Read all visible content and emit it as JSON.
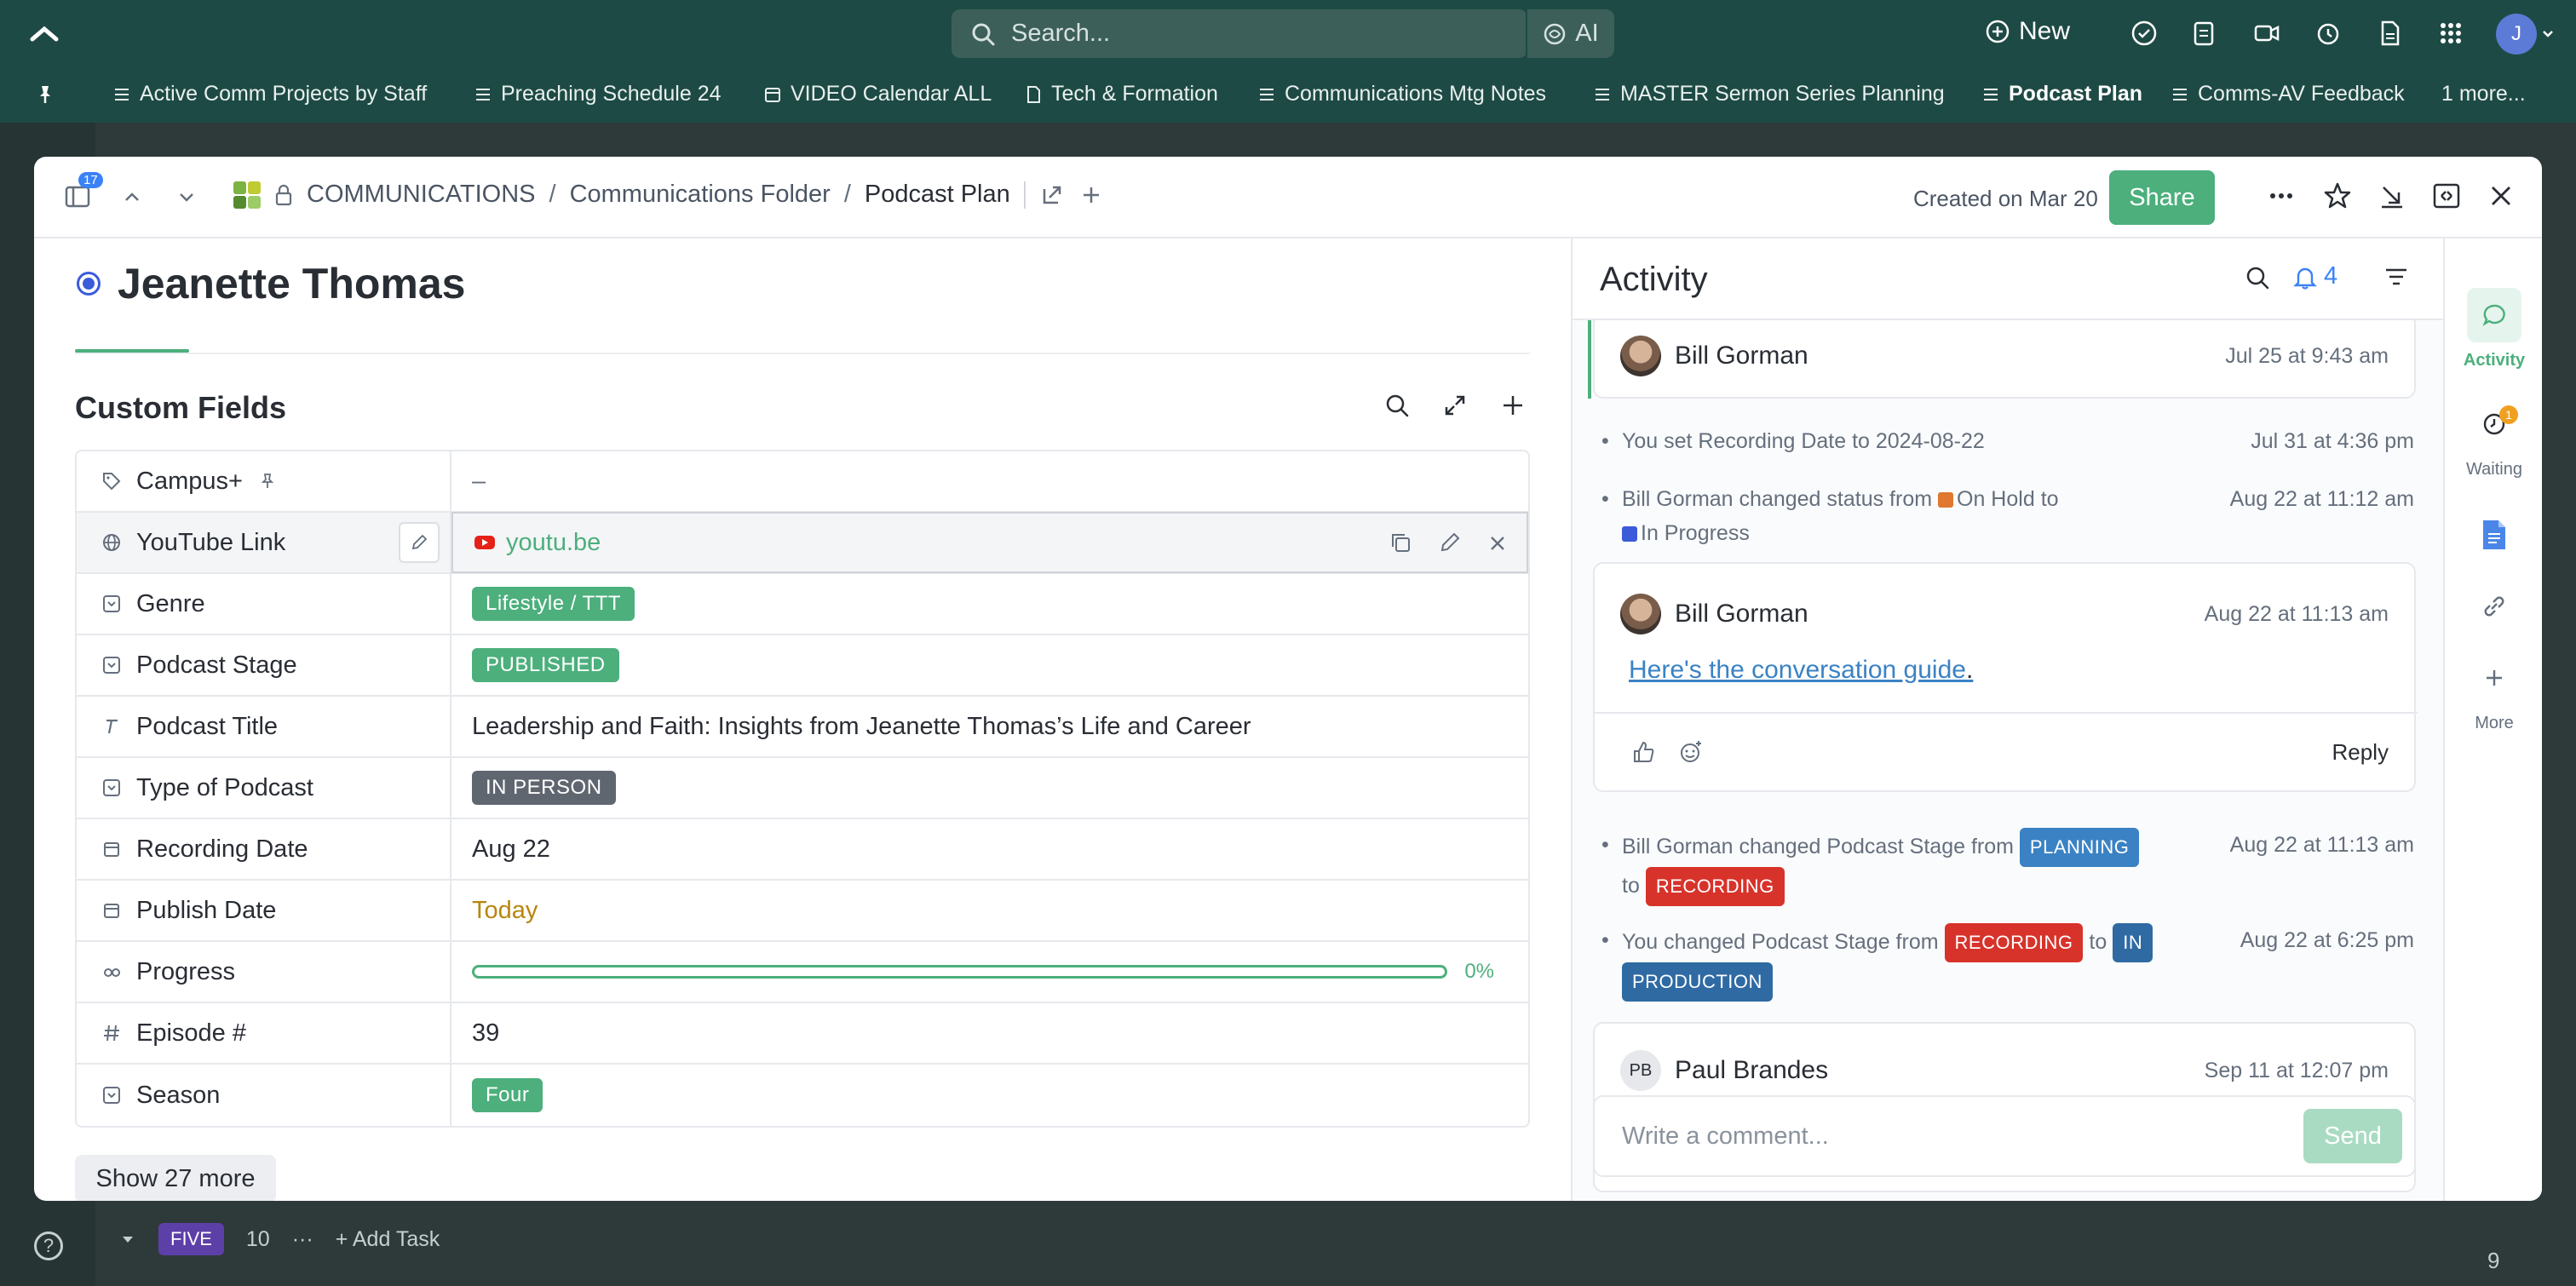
{
  "topbar": {
    "search_placeholder": "Search...",
    "ai_label": "AI",
    "new_label": "New",
    "avatar_initial": "J"
  },
  "favorites": [
    {
      "label": "Active Comm Projects by Staff",
      "icon": "list-icon"
    },
    {
      "label": "Preaching Schedule 24",
      "icon": "list-icon"
    },
    {
      "label": "VIDEO Calendar ALL",
      "icon": "calendar-icon"
    },
    {
      "label": "Tech & Formation",
      "icon": "doc-icon"
    },
    {
      "label": "Communications Mtg Notes",
      "icon": "list-icon"
    },
    {
      "label": "MASTER Sermon Series Planning",
      "icon": "list-icon"
    },
    {
      "label": "Podcast Plan",
      "icon": "list-icon",
      "active": true
    },
    {
      "label": "Comms-AV Feedback",
      "icon": "list-icon"
    },
    {
      "label": "1 more..."
    }
  ],
  "modal": {
    "panel_count": "17",
    "breadcrumb": {
      "space": "COMMUNICATIONS",
      "folder": "Communications Folder",
      "list": "Podcast Plan"
    },
    "created": "Created on Mar 20",
    "share_label": "Share",
    "task_title": "Jeanette Thomas",
    "custom_fields_heading": "Custom Fields",
    "show_more": "Show 27 more"
  },
  "fields": {
    "campus": {
      "name": "Campus+",
      "value": "–"
    },
    "youtube": {
      "name": "YouTube Link",
      "value": "youtu.be"
    },
    "genre": {
      "name": "Genre",
      "value": "Lifestyle / TTT"
    },
    "stage": {
      "name": "Podcast Stage",
      "value": "PUBLISHED"
    },
    "title": {
      "name": "Podcast Title",
      "value": "Leadership and Faith: Insights from Jeanette Thomas’s Life and Career"
    },
    "type": {
      "name": "Type of Podcast",
      "value": "IN PERSON"
    },
    "recording": {
      "name": "Recording Date",
      "value": "Aug 22"
    },
    "publish": {
      "name": "Publish Date",
      "value": "Today"
    },
    "progress": {
      "name": "Progress",
      "value": "0%",
      "fraction": 0
    },
    "episode": {
      "name": "Episode #",
      "value": "39"
    },
    "season": {
      "name": "Season",
      "value": "Four"
    }
  },
  "activity": {
    "title": "Activity",
    "notif_count": "4",
    "items": {
      "c1": {
        "author": "Bill Gorman",
        "time": "Jul 25 at 9:43 am"
      },
      "e1": {
        "text": "You set Recording Date to 2024-08-22",
        "time": "Jul 31 at 4:36 pm"
      },
      "e2": {
        "prefix": "Bill Gorman changed status from",
        "from": "On Hold",
        "to_word": "to",
        "to": "In Progress",
        "time": "Aug 22 at 11:12 am"
      },
      "c2": {
        "author": "Bill Gorman",
        "time": "Aug 22 at 11:13 am",
        "link": "Here's the conversation guide",
        "suffix": ".",
        "reply": "Reply"
      },
      "e3": {
        "prefix": "Bill Gorman changed Podcast Stage from",
        "from": "PLANNING",
        "to_word": "to",
        "to": "RECORDING",
        "time": "Aug 22 at 11:13 am"
      },
      "e4": {
        "prefix": "You changed Podcast Stage from",
        "from": "RECORDING",
        "to_word": "to",
        "to_a": "IN",
        "to_b": "PRODUCTION",
        "time": "Aug 22 at 6:25 pm"
      },
      "c3": {
        "author": "Paul Brandes",
        "initials": "PB",
        "time": "Sep 11 at 12:07 pm"
      }
    },
    "comment_placeholder": "Write a comment...",
    "send_label": "Send"
  },
  "rail": {
    "activity": "Activity",
    "waiting": "Waiting",
    "waiting_badge": "1",
    "more": "More"
  },
  "background": {
    "group_badge": "FIVE",
    "group_count": "10",
    "add_task": "Add Task",
    "bottom_count": "9"
  },
  "colors": {
    "brand_green": "#4caf7c",
    "topbar": "#1e4a45",
    "on_hold": "#e0782f",
    "in_progress": "#3b5bdb",
    "planning": "#3b82c4",
    "recording": "#d7332b"
  }
}
